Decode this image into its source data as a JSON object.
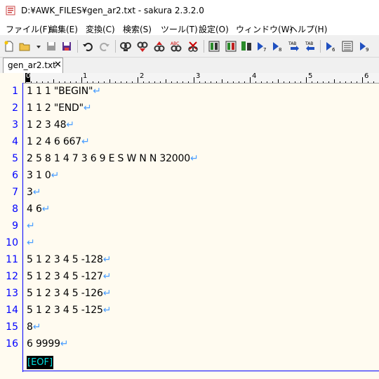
{
  "window": {
    "title": "D:¥AWK_FILES¥gen_ar2.txt - sakura 2.3.2.0"
  },
  "menu": [
    "ファイル(F)",
    "編集(E)",
    "変換(C)",
    "検索(S)",
    "ツール(T)",
    "設定(O)",
    "ウィンドウ(W)",
    "ヘルプ(H)"
  ],
  "toolbar": {
    "icons": [
      "new-file-icon",
      "open-folder-icon",
      "dropdown-arrow-icon",
      "save-icon",
      "save-all-icon",
      "undo-icon",
      "redo-icon",
      "search-icon",
      "search-prev-icon",
      "search-next-icon",
      "replace-icon",
      "clear-marks-icon",
      "grep-icon",
      "grep-replace-icon",
      "compare-icon",
      "jump-icon",
      "bookmark-next-icon",
      "tab-next-icon",
      "tab-prev-icon",
      "outline-icon",
      "list-icon",
      "bookmark-icon"
    ]
  },
  "tab": {
    "label": "gen_ar2.txt",
    "close": "✕"
  },
  "ruler": {
    "marks": [
      "0",
      "1",
      "2",
      "3",
      "4",
      "5",
      "6"
    ]
  },
  "editor": {
    "lines": [
      {
        "num": "1",
        "text": "1 1 1 \"BEGIN\""
      },
      {
        "num": "2",
        "text": "1 1 2 \"END\""
      },
      {
        "num": "3",
        "text": "1 2 3 48"
      },
      {
        "num": "4",
        "text": "1 2 4 6 667"
      },
      {
        "num": "5",
        "text": "2 5 8 1 4 7 3 6 9 E S W N N 32000"
      },
      {
        "num": "6",
        "text": "3 1 0"
      },
      {
        "num": "7",
        "text": "3"
      },
      {
        "num": "8",
        "text": "4 6"
      },
      {
        "num": "9",
        "text": ""
      },
      {
        "num": "10",
        "text": ""
      },
      {
        "num": "11",
        "text": "5 1 2 3 4 5 -128"
      },
      {
        "num": "12",
        "text": "5 1 2 3 4 5 -127"
      },
      {
        "num": "13",
        "text": "5 1 2 3 4 5 -126"
      },
      {
        "num": "14",
        "text": "5 1 2 3 4 5 -125"
      },
      {
        "num": "15",
        "text": "8"
      },
      {
        "num": "16",
        "text": "6 9999"
      }
    ],
    "eol_mark": "↵",
    "eof_mark": "[EOF]"
  },
  "colors": {
    "line_number": "#0000ff",
    "eol": "#4a9eff",
    "background": "#fffbf0",
    "eof_fg": "#00e0e0"
  }
}
